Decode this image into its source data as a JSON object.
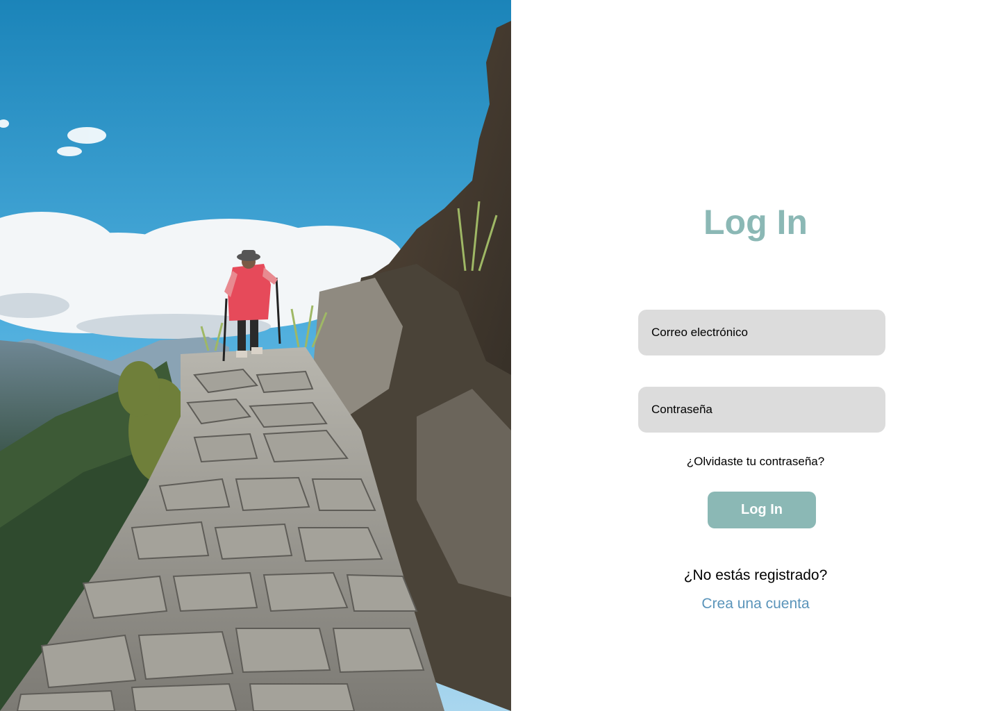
{
  "hero": {
    "image": "mountain-stone-trail-hiker-photo"
  },
  "login": {
    "title": "Log In",
    "email_placeholder": "Correo electrónico",
    "password_placeholder": "Contraseña",
    "forgot_password": "¿Olvidaste tu contraseña?",
    "submit_label": "Log In",
    "register_question": "¿No estás registrado?",
    "create_account": "Crea una cuenta"
  },
  "colors": {
    "accent": "#8BB8B5",
    "input_bg": "#DCDCDC",
    "link": "#5A94BA",
    "text": "#000000",
    "background": "#FFFFFF"
  }
}
